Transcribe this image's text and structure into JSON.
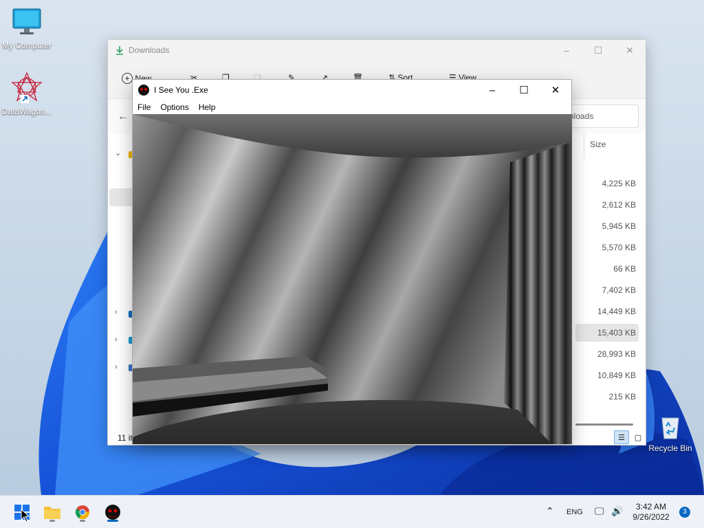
{
  "desktop": {
    "icons": [
      {
        "label": "My Computer",
        "icon": "monitor-icon"
      },
      {
        "label": "DataWagon...",
        "icon": "datawagon-app-icon"
      },
      {
        "label": "Recycle Bin",
        "icon": "recycle-bin-icon"
      }
    ]
  },
  "explorer": {
    "title": "Downloads",
    "commands": {
      "new": "New",
      "sort": "Sort",
      "view": "View",
      "more": "..."
    },
    "search_text": "nloads",
    "size_header": "Size",
    "sizes": [
      "4,225 KB",
      "2,612 KB",
      "5,945 KB",
      "5,570 KB",
      "66 KB",
      "7,402 KB",
      "14,449 KB",
      "15,403 KB",
      "28,993 KB",
      "10,849 KB",
      "215 KB"
    ],
    "selected_row_index": 7,
    "status": "11 it"
  },
  "game_window": {
    "title": "I See You .Exe",
    "menu": [
      "File",
      "Options",
      "Help"
    ]
  },
  "taskbar": {
    "apps": [
      "start-icon",
      "file-explorer-icon",
      "chrome-icon",
      "i-see-you-exe-icon"
    ],
    "language": "ENG",
    "time": "3:42 AM",
    "date": "9/26/2022",
    "notification_count": "3"
  },
  "colors": {
    "accent": "#0067c0",
    "wallpaper_bloom": "#1e63e6"
  }
}
